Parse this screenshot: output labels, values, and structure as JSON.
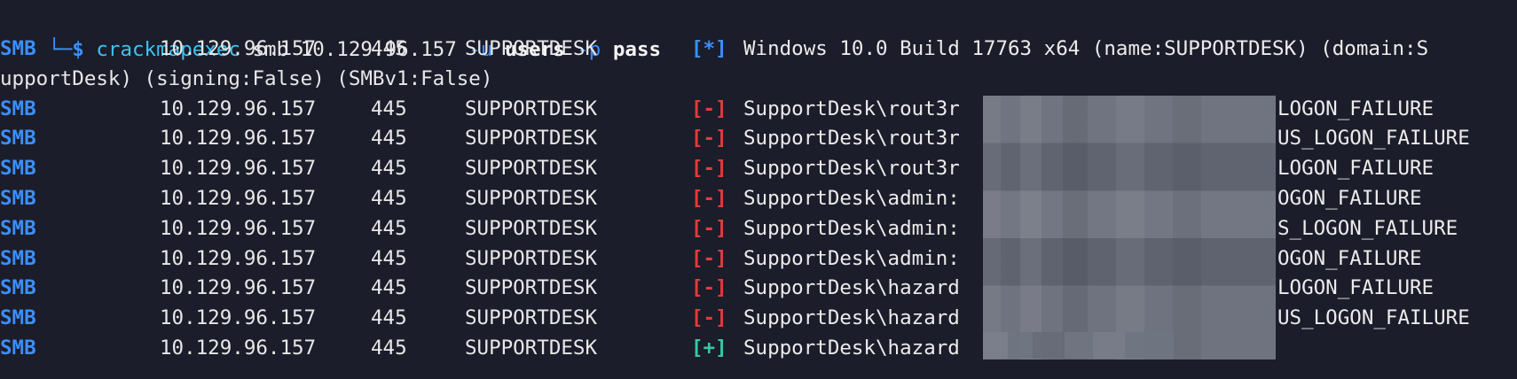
{
  "terminal": {
    "command": {
      "prompt_branch": "└─",
      "prompt_symbol": "$",
      "program": "crackmapexec",
      "args": [
        {
          "text": " smb 10.129.96.157 ",
          "style": "arg"
        },
        {
          "text": "-u",
          "style": "flag"
        },
        {
          "text": " ",
          "style": "arg"
        },
        {
          "text": "users",
          "style": "bold"
        },
        {
          "text": " ",
          "style": "arg"
        },
        {
          "text": "-p",
          "style": "flag"
        },
        {
          "text": " ",
          "style": "arg"
        },
        {
          "text": "pass",
          "style": "bold"
        }
      ]
    },
    "rows": [
      {
        "proto": "SMB",
        "ip": "10.129.96.157",
        "port": "445",
        "host": "SUPPORTDESK",
        "status_symbol": "*",
        "status_kind": "info",
        "message": "Windows 10.0 Build 17763 x64 (name:SUPPORTDESK) (domain:S",
        "tail": ""
      },
      {
        "wrap": "upportDesk) (signing:False) (SMBv1:False)"
      },
      {
        "proto": "SMB",
        "ip": "10.129.96.157",
        "port": "445",
        "host": "SUPPORTDESK",
        "status_symbol": "-",
        "status_kind": "fail",
        "message": "SupportDesk\\rout3r",
        "tail": "LOGON_FAILURE"
      },
      {
        "proto": "SMB",
        "ip": "10.129.96.157",
        "port": "445",
        "host": "SUPPORTDESK",
        "status_symbol": "-",
        "status_kind": "fail",
        "message": "SupportDesk\\rout3r",
        "tail": "US_LOGON_FAILURE"
      },
      {
        "proto": "SMB",
        "ip": "10.129.96.157",
        "port": "445",
        "host": "SUPPORTDESK",
        "status_symbol": "-",
        "status_kind": "fail",
        "message": "SupportDesk\\rout3r",
        "tail": "LOGON_FAILURE"
      },
      {
        "proto": "SMB",
        "ip": "10.129.96.157",
        "port": "445",
        "host": "SUPPORTDESK",
        "status_symbol": "-",
        "status_kind": "fail",
        "message": "SupportDesk\\admin:",
        "tail": "OGON_FAILURE"
      },
      {
        "proto": "SMB",
        "ip": "10.129.96.157",
        "port": "445",
        "host": "SUPPORTDESK",
        "status_symbol": "-",
        "status_kind": "fail",
        "message": "SupportDesk\\admin:",
        "tail": "S_LOGON_FAILURE"
      },
      {
        "proto": "SMB",
        "ip": "10.129.96.157",
        "port": "445",
        "host": "SUPPORTDESK",
        "status_symbol": "-",
        "status_kind": "fail",
        "message": "SupportDesk\\admin:",
        "tail": "OGON_FAILURE"
      },
      {
        "proto": "SMB",
        "ip": "10.129.96.157",
        "port": "445",
        "host": "SUPPORTDESK",
        "status_symbol": "-",
        "status_kind": "fail",
        "message": "SupportDesk\\hazard",
        "tail": "LOGON_FAILURE"
      },
      {
        "proto": "SMB",
        "ip": "10.129.96.157",
        "port": "445",
        "host": "SUPPORTDESK",
        "status_symbol": "-",
        "status_kind": "fail",
        "message": "SupportDesk\\hazard",
        "tail": "US_LOGON_FAILURE"
      },
      {
        "proto": "SMB",
        "ip": "10.129.96.157",
        "port": "445",
        "host": "SUPPORTDESK",
        "status_symbol": "+",
        "status_kind": "ok",
        "message": "SupportDesk\\hazard",
        "tail": ""
      }
    ]
  },
  "colors": {
    "background": "#1b1d2a",
    "proto": "#3c8ffb",
    "fail": "#e03c3c",
    "ok": "#35c9a3",
    "info": "#3c8ffb",
    "program": "#3ec3f2"
  },
  "icons": {
    "redaction": "pixelated-redaction"
  }
}
